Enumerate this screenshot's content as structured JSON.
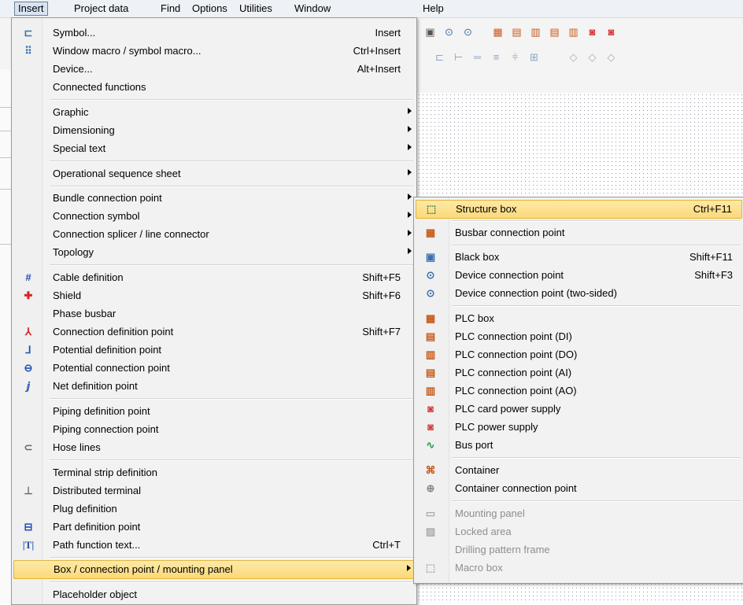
{
  "menubar": {
    "items": [
      "Insert",
      "Project data",
      "Find",
      "Options",
      "Utilities",
      "Window",
      "Help"
    ]
  },
  "main_menu": {
    "items": [
      {
        "label": "Symbol...",
        "shortcut": "Insert",
        "icon": "symbol-icon"
      },
      {
        "label": "Window macro / symbol macro...",
        "shortcut": "Ctrl+Insert",
        "icon": "macro-icon"
      },
      {
        "label": "Device...",
        "shortcut": "Alt+Insert"
      },
      {
        "label": "Connected functions"
      },
      {
        "label": "Graphic",
        "submenu": true
      },
      {
        "label": "Dimensioning",
        "submenu": true
      },
      {
        "label": "Special text",
        "submenu": true
      },
      {
        "label": "Operational sequence sheet",
        "submenu": true
      },
      {
        "label": "Bundle connection point",
        "submenu": true
      },
      {
        "label": "Connection symbol",
        "submenu": true
      },
      {
        "label": "Connection splicer / line connector",
        "submenu": true
      },
      {
        "label": "Topology",
        "submenu": true
      },
      {
        "label": "Cable definition",
        "shortcut": "Shift+F5",
        "icon": "cable-icon"
      },
      {
        "label": "Shield",
        "shortcut": "Shift+F6",
        "icon": "shield-icon"
      },
      {
        "label": "Phase busbar"
      },
      {
        "label": "Connection definition point",
        "shortcut": "Shift+F7",
        "icon": "connection-definition-icon"
      },
      {
        "label": "Potential definition point",
        "icon": "potential-definition-icon"
      },
      {
        "label": "Potential connection point",
        "icon": "potential-connection-icon"
      },
      {
        "label": "Net definition point",
        "icon": "net-definition-icon"
      },
      {
        "label": "Piping definition point"
      },
      {
        "label": "Piping connection point"
      },
      {
        "label": "Hose lines",
        "icon": "hose-icon"
      },
      {
        "label": "Terminal strip definition"
      },
      {
        "label": "Distributed terminal",
        "icon": "terminal-icon"
      },
      {
        "label": "Plug definition"
      },
      {
        "label": "Part definition point",
        "icon": "cart-icon"
      },
      {
        "label": "Path function text...",
        "shortcut": "Ctrl+T",
        "icon": "text-icon"
      },
      {
        "label": "Box / connection point / mounting panel",
        "submenu": true
      },
      {
        "label": "Placeholder object"
      }
    ]
  },
  "sub_menu": {
    "items": [
      {
        "label": "Structure box",
        "shortcut": "Ctrl+F11",
        "icon": "structure-box-icon"
      },
      {
        "label": "Busbar connection point",
        "icon": "busbar-icon"
      },
      {
        "label": "Black box",
        "shortcut": "Shift+F11",
        "icon": "black-box-icon"
      },
      {
        "label": "Device connection point",
        "shortcut": "Shift+F3",
        "icon": "device-connection-icon"
      },
      {
        "label": "Device connection point (two-sided)",
        "icon": "device-connection-two-sided-icon"
      },
      {
        "label": "PLC box",
        "icon": "plc-box-icon"
      },
      {
        "label": "PLC connection point (DI)",
        "icon": "plc-di-icon"
      },
      {
        "label": "PLC connection point (DO)",
        "icon": "plc-do-icon"
      },
      {
        "label": "PLC connection point (AI)",
        "icon": "plc-ai-icon"
      },
      {
        "label": "PLC connection point (AO)",
        "icon": "plc-ao-icon"
      },
      {
        "label": "PLC card power supply",
        "icon": "plc-card-power-icon"
      },
      {
        "label": "PLC power supply",
        "icon": "plc-power-icon"
      },
      {
        "label": "Bus port",
        "icon": "bus-port-icon"
      },
      {
        "label": "Container",
        "icon": "container-icon"
      },
      {
        "label": "Container connection point",
        "icon": "container-connection-icon"
      },
      {
        "label": "Mounting panel",
        "icon": "mounting-panel-icon"
      },
      {
        "label": "Locked area",
        "icon": "locked-area-icon"
      },
      {
        "label": "Drilling pattern frame"
      },
      {
        "label": "Macro box",
        "icon": "macro-box-icon"
      }
    ]
  },
  "colors": {
    "highlight": "#fbd978",
    "highlight_border": "#e3b53a",
    "menu_bg": "#f2f2f2",
    "disabled_text": "#8e8e8e"
  }
}
